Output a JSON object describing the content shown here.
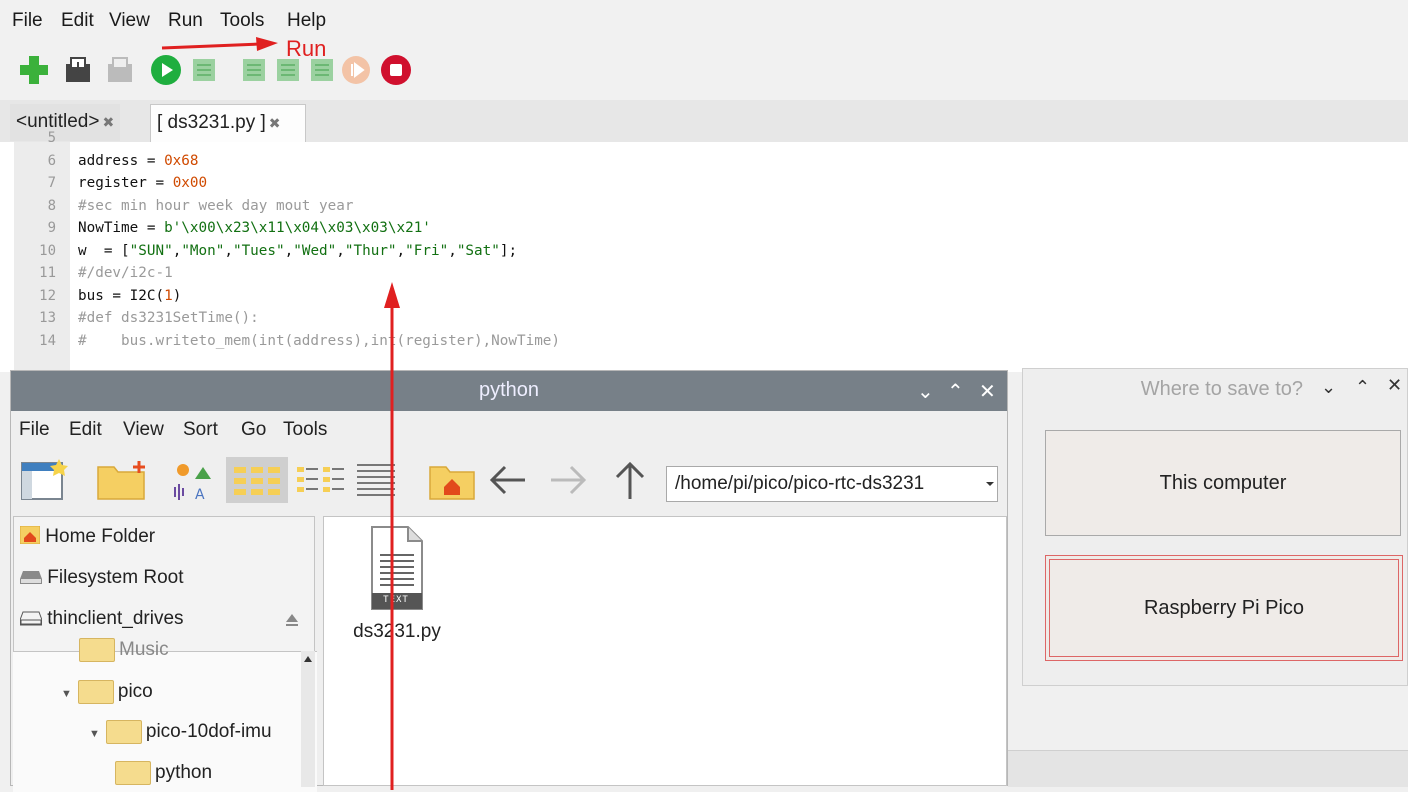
{
  "editor": {
    "menu": [
      "File",
      "Edit",
      "View",
      "Run",
      "Tools",
      "Help"
    ],
    "annotation_run": "Run",
    "tabs": [
      {
        "label": "<untitled>",
        "close": "✖"
      },
      {
        "label": "[ ds3231.py ]",
        "close": "✖"
      }
    ],
    "code_lines": [
      {
        "n": "5",
        "parts": []
      },
      {
        "n": "6",
        "parts": [
          {
            "t": "address = ",
            "c": ""
          },
          {
            "t": "0x68",
            "c": "num"
          }
        ]
      },
      {
        "n": "7",
        "parts": [
          {
            "t": "register = ",
            "c": ""
          },
          {
            "t": "0x00",
            "c": "num"
          }
        ]
      },
      {
        "n": "8",
        "parts": [
          {
            "t": "#sec min hour week day mout year",
            "c": "cmt"
          }
        ]
      },
      {
        "n": "9",
        "parts": [
          {
            "t": "NowTime = ",
            "c": ""
          },
          {
            "t": "b'\\x00\\x23\\x11\\x04\\x03\\x03\\x21'",
            "c": "str"
          }
        ]
      },
      {
        "n": "10",
        "parts": [
          {
            "t": "w  = [",
            "c": ""
          },
          {
            "t": "\"SUN\"",
            "c": "str"
          },
          {
            "t": ",",
            "c": ""
          },
          {
            "t": "\"Mon\"",
            "c": "str"
          },
          {
            "t": ",",
            "c": ""
          },
          {
            "t": "\"Tues\"",
            "c": "str"
          },
          {
            "t": ",",
            "c": ""
          },
          {
            "t": "\"Wed\"",
            "c": "str"
          },
          {
            "t": ",",
            "c": ""
          },
          {
            "t": "\"Thur\"",
            "c": "str"
          },
          {
            "t": ",",
            "c": ""
          },
          {
            "t": "\"Fri\"",
            "c": "str"
          },
          {
            "t": ",",
            "c": ""
          },
          {
            "t": "\"Sat\"",
            "c": "str"
          },
          {
            "t": "];",
            "c": ""
          }
        ]
      },
      {
        "n": "11",
        "parts": [
          {
            "t": "#/dev/i2c-1",
            "c": "cmt"
          }
        ]
      },
      {
        "n": "12",
        "parts": [
          {
            "t": "bus = I2C(",
            "c": ""
          },
          {
            "t": "1",
            "c": "num"
          },
          {
            "t": ")",
            "c": ""
          }
        ]
      },
      {
        "n": "13",
        "parts": [
          {
            "t": "#def ds3231SetTime():",
            "c": "cmt"
          }
        ]
      },
      {
        "n": "14",
        "parts": [
          {
            "t": "#    bus.writeto_mem(int(address),int(register),NowTime)",
            "c": "cmt"
          }
        ]
      }
    ]
  },
  "file_manager": {
    "title": "python",
    "menu": [
      "File",
      "Edit",
      "View",
      "Sort",
      "Go",
      "Tools"
    ],
    "path": "/home/pi/pico/pico-rtc-ds3231",
    "places": [
      "Home Folder",
      "Filesystem Root",
      "thinclient_drives"
    ],
    "tree": [
      "Music",
      "pico",
      "pico-10dof-imu",
      "python"
    ],
    "file": {
      "name": "ds3231.py",
      "badge": "TEXT"
    }
  },
  "save_dialog": {
    "title": "Where to save to?",
    "option_computer": "This computer",
    "option_pico": "Raspberry Pi Pico"
  }
}
